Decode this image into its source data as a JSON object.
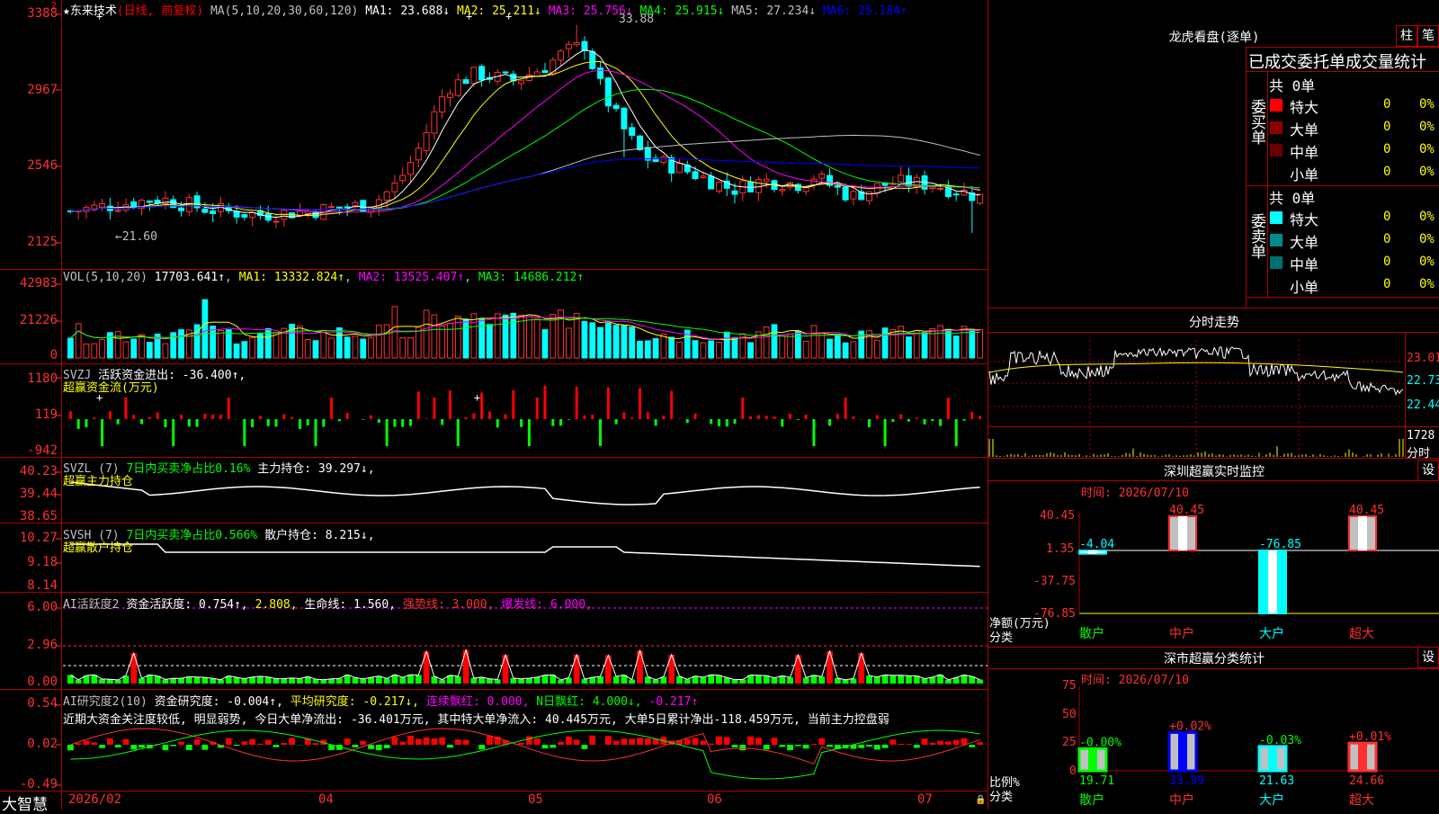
{
  "app": {
    "name": "大智慧",
    "stock": "东来技术",
    "mode": "(日线, 前复权)"
  },
  "price_panel": {
    "ma_label": "MA(5,10,20,30,60,120)",
    "ma": [
      {
        "text": "MA1: 23.688↓",
        "color": "#ffffff"
      },
      {
        "text": "MA2: 25.211↓",
        "color": "#ffff00"
      },
      {
        "text": "MA3: 25.756↓",
        "color": "#ff00ff"
      },
      {
        "text": "MA4: 25.915↓",
        "color": "#00ff00"
      },
      {
        "text": "MA5: 27.234↓",
        "color": "#c0c0c0"
      },
      {
        "text": "MA6: 25.184↑",
        "color": "#0000ff"
      }
    ],
    "yticks": [
      "3388",
      "2967",
      "2546",
      "2125"
    ],
    "high_label": "33.88",
    "low_label": "←21.60",
    "ylim": [
      21.25,
      33.88
    ]
  },
  "vol_panel": {
    "label": "VOL(5,10,20)",
    "value": "17703.641↑",
    "ma1": "MA1: 13332.824↑",
    "ma2": "MA2: 13525.407↑",
    "ma3": "MA3: 14686.212↑",
    "yticks": [
      "42983",
      "21226",
      "0"
    ]
  },
  "svzj_panel": {
    "label": "SVZJ",
    "text": "活跃资金进出: -36.400↑,",
    "sub": "超赢资金流(万元)",
    "yticks": [
      "1180",
      "119",
      "-942"
    ]
  },
  "svzl_panel": {
    "label": "SVZL (7)",
    "pct": "7日内买卖净占比0.16%",
    "main": "主力持仓: 39.297↓,",
    "sub": "超赢主力持仓",
    "yticks": [
      "40.23",
      "39.44",
      "38.65"
    ]
  },
  "svsh_panel": {
    "label": "SVSH (7)",
    "pct": "7日内买卖净占比0.566%",
    "main": "散户持仓: 8.215↓,",
    "sub": "超赢散户持仓",
    "yticks": [
      "10.27",
      "9.18",
      "8.14"
    ]
  },
  "ai1_panel": {
    "label": "AI活跃度2",
    "t1": "资金活跃度: 0.754↑,",
    "t2": "2.808,",
    "t3": "生命线: 1.560,",
    "t4": "强势线: 3.000,",
    "t5": "爆发线: 6.000,",
    "yticks": [
      "6.00",
      "2.96",
      "0.00"
    ]
  },
  "ai2_panel": {
    "label": "AI研究度2(10)",
    "t1": "资金研究度: -0.004↑,",
    "t2": "平均研究度: -0.217↓,",
    "t3": "连续飘红: 0.000,",
    "t4": "N日飘红: 4.000↓,",
    "t5": "-0.217↑",
    "comment": "近期大资金关注度较低, 明显弱势, 今日大单净流出: -36.401万元, 其中特大单净流入: 40.445万元, 大单5日累计净出-118.459万元, 当前主力控盘弱",
    "yticks": [
      "0.54",
      "0.02",
      "-0.49"
    ]
  },
  "x_axis": {
    "labels": [
      "2026/02",
      "04",
      "05",
      "06",
      "07"
    ]
  },
  "longhu": {
    "title": "龙虎看盘(逐单)",
    "btn_zhu": "柱",
    "btn_bi": "笔",
    "header": "已成交委托单成交量统计",
    "buy": {
      "vlabel": "委买单",
      "total": "共 0单",
      "rows": [
        {
          "name": "特大",
          "count": "0",
          "pct": "0%",
          "color": "#ff0000"
        },
        {
          "name": "大单",
          "count": "0",
          "pct": "0%",
          "color": "#8b0000"
        },
        {
          "name": "中单",
          "count": "0",
          "pct": "0%",
          "color": "#6a0000"
        },
        {
          "name": "小单",
          "count": "0",
          "pct": "0%",
          "color": "#000000"
        }
      ]
    },
    "sell": {
      "vlabel": "委卖单",
      "total": "共 0单",
      "rows": [
        {
          "name": "特大",
          "count": "0",
          "pct": "0%",
          "color": "#00ffff"
        },
        {
          "name": "大单",
          "count": "0",
          "pct": "0%",
          "color": "#008b8b"
        },
        {
          "name": "中单",
          "count": "0",
          "pct": "0%",
          "color": "#007070"
        },
        {
          "name": "小单",
          "count": "0",
          "pct": "0%",
          "color": "#000000"
        }
      ]
    }
  },
  "intraday": {
    "title": "分时走势",
    "yticks": [
      "23.01",
      "22.73",
      "22.44"
    ],
    "vol_value": "1728",
    "vol_unit": "分时"
  },
  "monitor": {
    "title": "深圳超赢实时监控",
    "btn": "设",
    "time": "时间: 2026/07/10",
    "yticks": [
      "40.45",
      "1.35",
      "-37.75",
      "-76.85"
    ],
    "ylabel": "净额(万元)",
    "xlabel": "分类",
    "categories": [
      "散户",
      "中户",
      "大户",
      "超大"
    ],
    "values": [
      -4.04,
      40.45,
      -76.85,
      40.45
    ],
    "labels": [
      "-4.04",
      "40.45",
      "-76.85",
      "40.45"
    ]
  },
  "classify": {
    "title": "深市超赢分类统计",
    "btn": "设",
    "time": "时间: 2026/07/10",
    "yticks": [
      "75",
      "50",
      "25",
      "0"
    ],
    "ylabel": "比例%",
    "xlabel": "分类",
    "categories": [
      "散户",
      "中户",
      "大户",
      "超大"
    ],
    "values": [
      19.71,
      33.99,
      21.63,
      24.66
    ],
    "changes": [
      "-0.00%",
      "+0.02%",
      "-0.03%",
      "+0.01%"
    ],
    "vals_text": [
      "19.71",
      "33.99",
      "21.63",
      "24.66"
    ]
  },
  "chart_data": [
    {
      "type": "candlestick",
      "ylim": [
        21.25,
        33.88
      ],
      "high": 33.88,
      "low": 21.6,
      "series": [
        {
          "name": "MA1",
          "value": 23.688
        },
        {
          "name": "MA2",
          "value": 25.211
        },
        {
          "name": "MA3",
          "value": 25.756
        },
        {
          "name": "MA4",
          "value": 25.915
        },
        {
          "name": "MA5",
          "value": 27.234
        },
        {
          "name": "MA6",
          "value": 25.184
        }
      ]
    },
    {
      "type": "bar",
      "name_text": "VOL(5,10,20)",
      "ylim": [
        0,
        42983
      ],
      "last": 17703.641,
      "series": [
        {
          "name": "MA1",
          "value": 13332.824
        },
        {
          "name": "MA2",
          "value": 13525.407
        },
        {
          "name": "MA3",
          "value": 14686.212
        }
      ]
    },
    {
      "type": "bar",
      "categories": [
        "散户",
        "中户",
        "大户",
        "超大"
      ],
      "values": [
        -4.04,
        40.45,
        -76.85,
        40.45
      ],
      "ylim": [
        -76.85,
        40.45
      ],
      "ylabel": "净额(万元)",
      "xlabel": "分类"
    },
    {
      "type": "bar",
      "categories": [
        "散户",
        "中户",
        "大户",
        "超大"
      ],
      "values": [
        19.71,
        33.99,
        21.63,
        24.66
      ],
      "ylim": [
        0,
        75
      ],
      "ylabel": "比例%",
      "xlabel": "分类"
    }
  ]
}
